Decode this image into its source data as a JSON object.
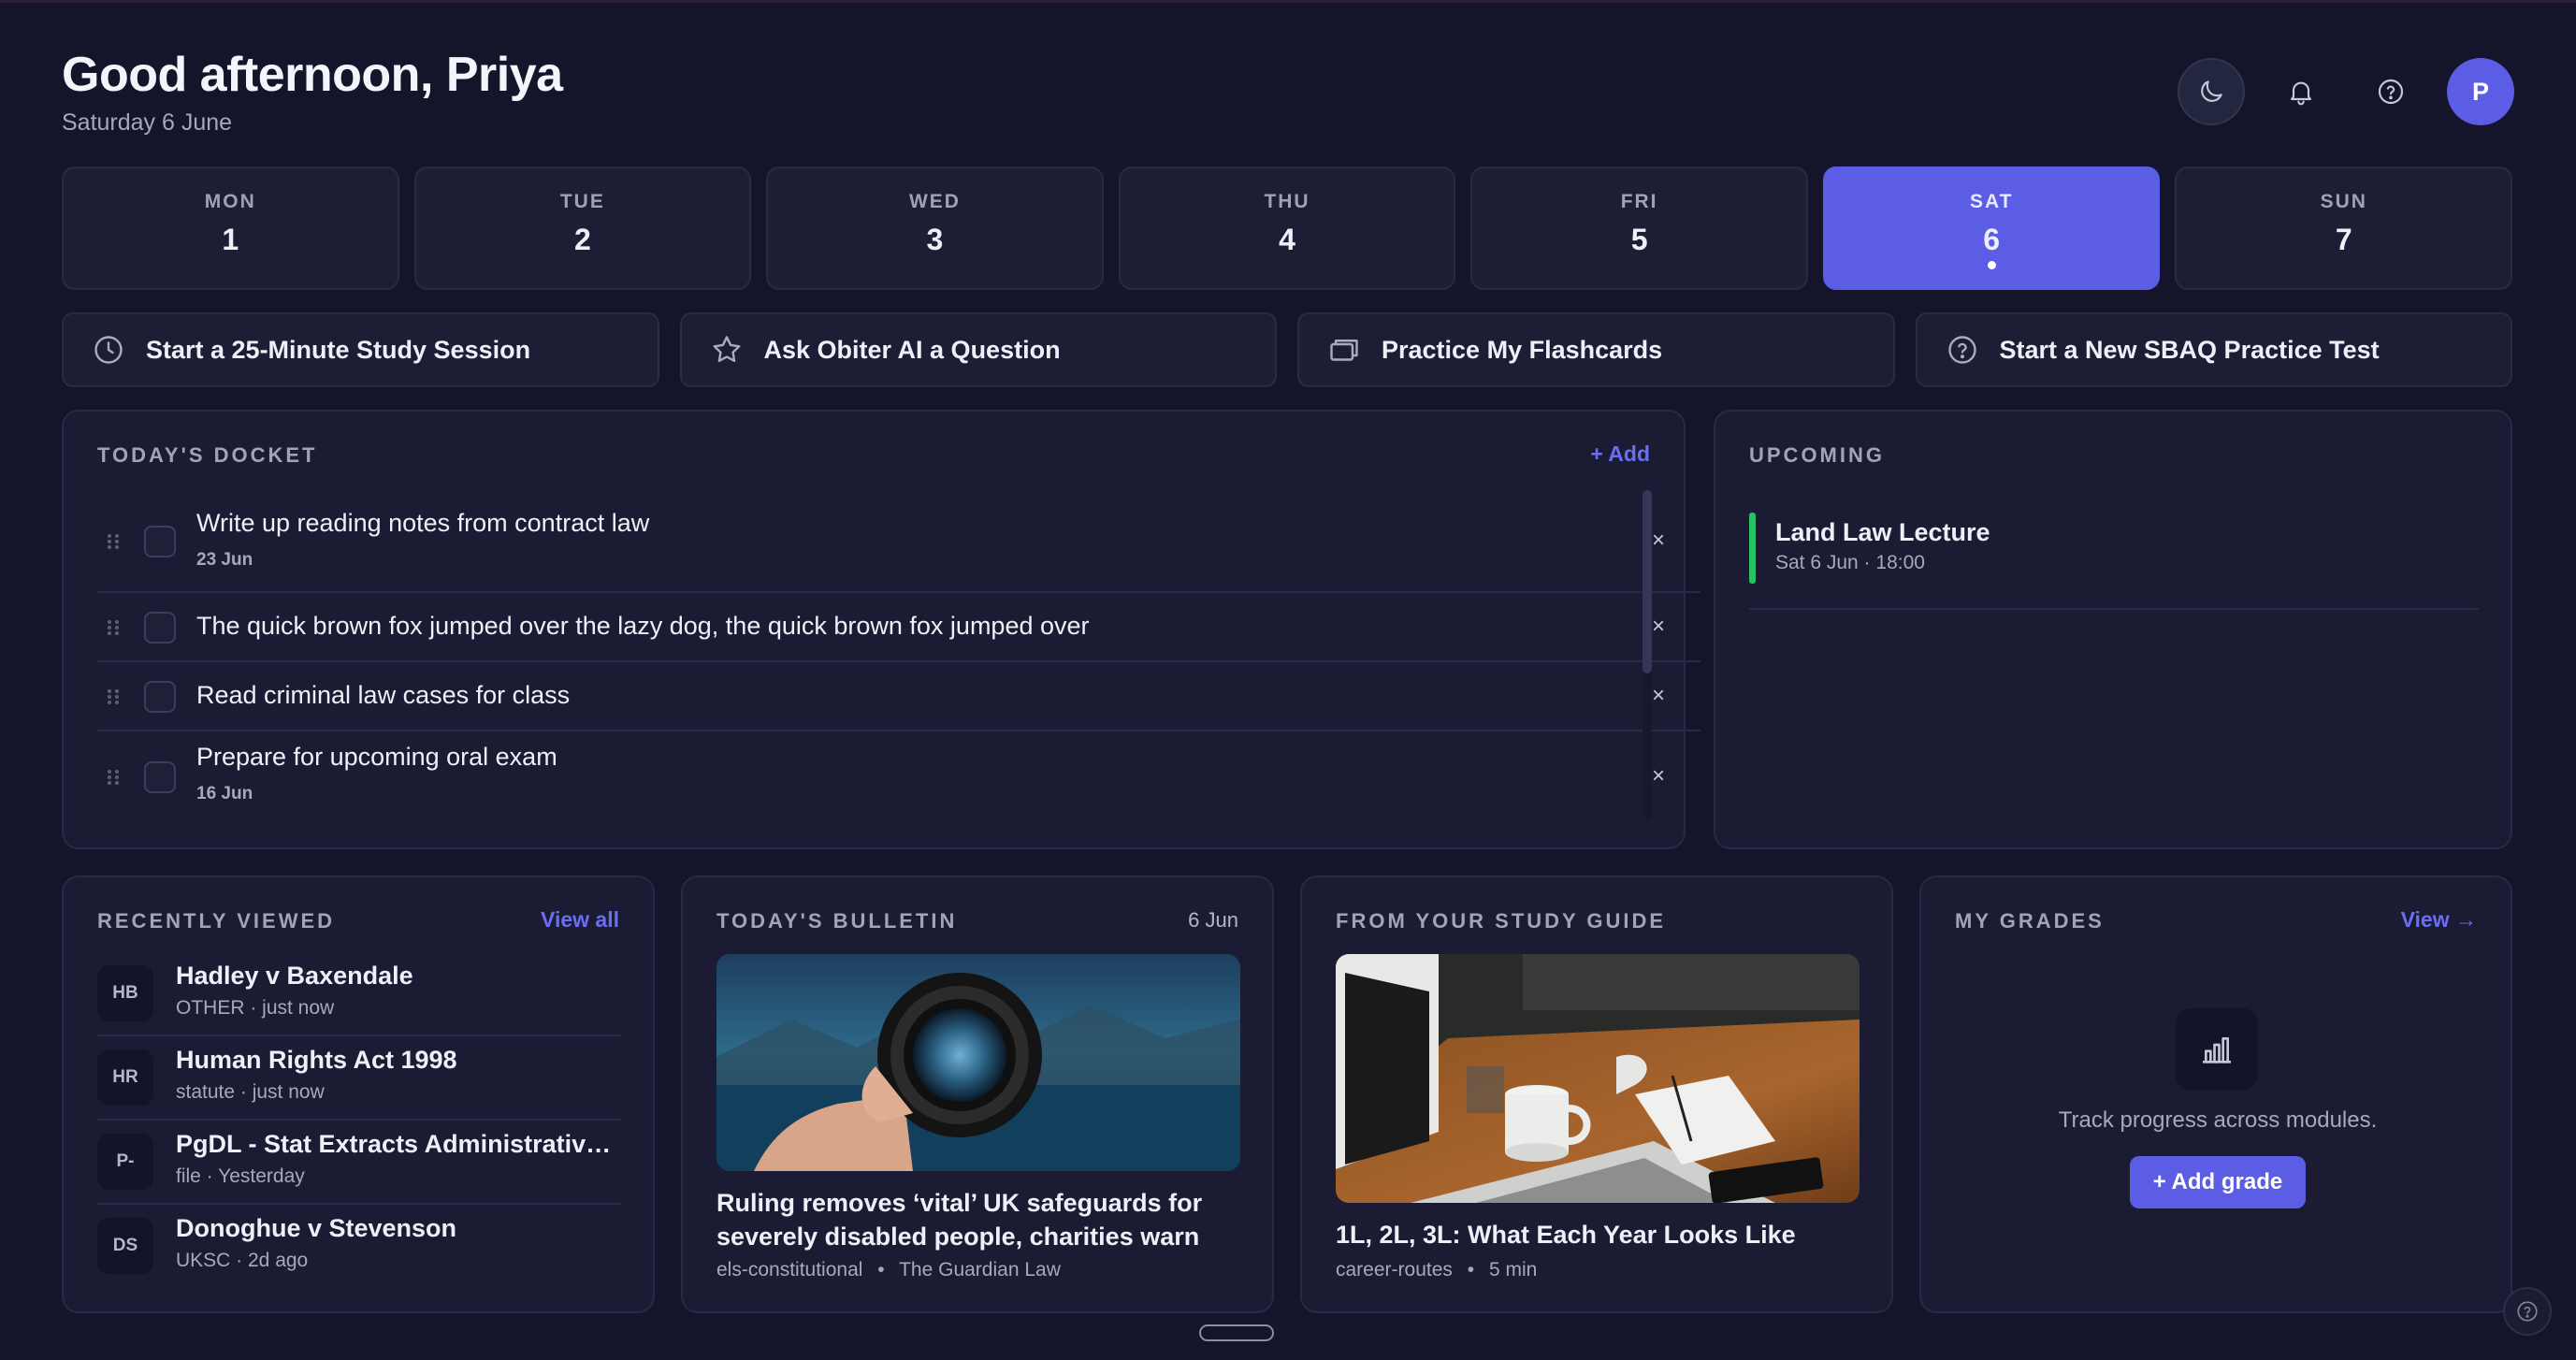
{
  "header": {
    "greeting": "Good afternoon, Priya",
    "date": "Saturday 6 June",
    "avatar_initial": "P"
  },
  "week": [
    {
      "day": "MON",
      "date": "1",
      "active": false
    },
    {
      "day": "TUE",
      "date": "2",
      "active": false
    },
    {
      "day": "WED",
      "date": "3",
      "active": false
    },
    {
      "day": "THU",
      "date": "4",
      "active": false
    },
    {
      "day": "FRI",
      "date": "5",
      "active": false
    },
    {
      "day": "SAT",
      "date": "6",
      "active": true
    },
    {
      "day": "SUN",
      "date": "7",
      "active": false
    }
  ],
  "actions": [
    {
      "label": "Start a 25-Minute Study Session",
      "icon": "clock-icon"
    },
    {
      "label": "Ask Obiter AI a Question",
      "icon": "star-icon"
    },
    {
      "label": "Practice My Flashcards",
      "icon": "cards-icon"
    },
    {
      "label": "Start a New SBAQ Practice Test",
      "icon": "question-icon"
    }
  ],
  "docket": {
    "title": "TODAY'S DOCKET",
    "add_label": "+ Add",
    "items": [
      {
        "text": "Write up reading notes from contract law",
        "due": "23 Jun"
      },
      {
        "text": "The quick brown fox jumped over the lazy dog, the quick brown fox jumped over",
        "due": ""
      },
      {
        "text": "Read criminal law cases for class",
        "due": ""
      },
      {
        "text": "Prepare for upcoming oral exam",
        "due": "16 Jun"
      }
    ],
    "remove_label": "×"
  },
  "upcoming": {
    "title": "UPCOMING",
    "events": [
      {
        "title": "Land Law Lecture",
        "meta": "Sat 6 Jun · 18:00",
        "color": "#28c064"
      }
    ]
  },
  "recent": {
    "title": "RECENTLY VIEWED",
    "link": "View all",
    "items": [
      {
        "badge": "HB",
        "title": "Hadley v Baxendale",
        "meta": "OTHER · just now"
      },
      {
        "badge": "HR",
        "title": "Human Rights Act 1998",
        "meta": "statute · just now"
      },
      {
        "badge": "P-",
        "title": "PgDL - Stat Extracts Administrative L...",
        "meta": "file · Yesterday"
      },
      {
        "badge": "DS",
        "title": "Donoghue v Stevenson",
        "meta": "UKSC · 2d ago"
      }
    ]
  },
  "bulletin": {
    "title": "TODAY'S BULLETIN",
    "date": "6 Jun",
    "headline": "Ruling removes ‘vital’ UK safeguards for severely disabled people, charities warn",
    "tag": "els-constitutional",
    "source": "The Guardian Law",
    "separator": "•"
  },
  "guide": {
    "title": "FROM YOUR STUDY GUIDE",
    "headline": "1L, 2L, 3L: What Each Year Looks Like",
    "tag": "career-routes",
    "read_time": "5 min",
    "separator": "•"
  },
  "grades": {
    "title": "MY GRADES",
    "link": "View →",
    "empty_text": "Track progress across modules.",
    "add_label": "+ Add grade"
  },
  "colors": {
    "accent": "#5b5de5",
    "background": "#14142a",
    "panel": "#1b1c34",
    "event_green": "#28c064"
  }
}
